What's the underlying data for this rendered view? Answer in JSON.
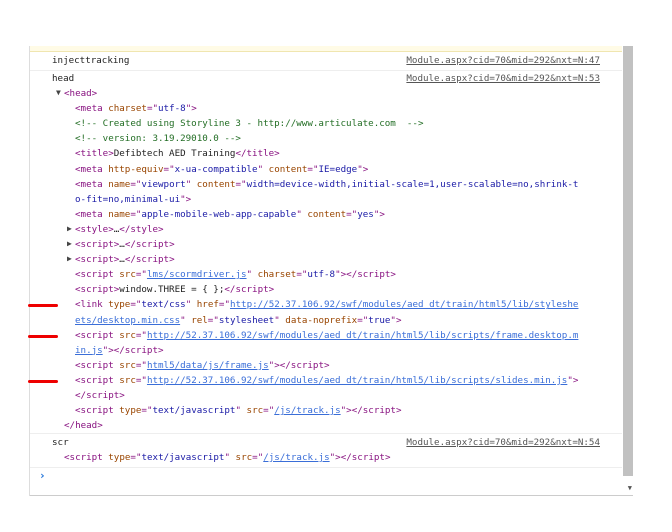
{
  "messages": [
    {
      "label": "injecttracking",
      "source": "Module.aspx?cid=70&mid=292&nxt=N:47"
    },
    {
      "label": "head",
      "source": "Module.aspx?cid=70&mid=292&nxt=N:53"
    },
    {
      "label": "scr",
      "source": "Module.aspx?cid=70&mid=292&nxt=N:54"
    }
  ],
  "head_lines": [
    {
      "indent": 0,
      "tri": "down",
      "tokens": [
        [
          "tag",
          "<head>"
        ]
      ]
    },
    {
      "indent": 1,
      "tokens": [
        [
          "tag",
          "<meta "
        ],
        [
          "attr",
          "charset"
        ],
        [
          "tag",
          "=\""
        ],
        [
          "val",
          "utf-8"
        ],
        [
          "tag",
          "\">"
        ]
      ]
    },
    {
      "indent": 1,
      "tokens": [
        [
          "comment",
          "<!-- Created using Storyline 3 - http://www.articulate.com  -->"
        ]
      ]
    },
    {
      "indent": 1,
      "tokens": [
        [
          "comment",
          "<!-- version: 3.19.29010.0 -->"
        ]
      ]
    },
    {
      "indent": 1,
      "tokens": [
        [
          "tag",
          "<title>"
        ],
        [
          "text",
          "Defibtech AED Training"
        ],
        [
          "tag",
          "</title>"
        ]
      ]
    },
    {
      "indent": 1,
      "tokens": [
        [
          "tag",
          "<meta "
        ],
        [
          "attr",
          "http-equiv"
        ],
        [
          "tag",
          "=\""
        ],
        [
          "val",
          "x-ua-compatible"
        ],
        [
          "tag",
          "\" "
        ],
        [
          "attr",
          "content"
        ],
        [
          "tag",
          "=\""
        ],
        [
          "val",
          "IE=edge"
        ],
        [
          "tag",
          "\">"
        ]
      ]
    },
    {
      "indent": 1,
      "tokens": [
        [
          "tag",
          "<meta "
        ],
        [
          "attr",
          "name"
        ],
        [
          "tag",
          "=\""
        ],
        [
          "val",
          "viewport"
        ],
        [
          "tag",
          "\" "
        ],
        [
          "attr",
          "content"
        ],
        [
          "tag",
          "=\""
        ],
        [
          "val",
          "width=device-width,initial-scale=1,user-scalable=no,shrink-t"
        ]
      ]
    },
    {
      "indent": 1,
      "tokens": [
        [
          "val",
          "o-fit=no,minimal-ui"
        ],
        [
          "tag",
          "\">"
        ]
      ]
    },
    {
      "indent": 1,
      "tokens": [
        [
          "tag",
          "<meta "
        ],
        [
          "attr",
          "name"
        ],
        [
          "tag",
          "=\""
        ],
        [
          "val",
          "apple-mobile-web-app-capable"
        ],
        [
          "tag",
          "\" "
        ],
        [
          "attr",
          "content"
        ],
        [
          "tag",
          "=\""
        ],
        [
          "val",
          "yes"
        ],
        [
          "tag",
          "\">"
        ]
      ]
    },
    {
      "indent": 1,
      "tri": "right",
      "tokens": [
        [
          "tag",
          "<style>"
        ],
        [
          "text",
          "…"
        ],
        [
          "tag",
          "</style>"
        ]
      ]
    },
    {
      "indent": 1,
      "tri": "right",
      "tokens": [
        [
          "tag",
          "<script>"
        ],
        [
          "text",
          "…"
        ],
        [
          "tag",
          "</script>"
        ]
      ]
    },
    {
      "indent": 1,
      "tri": "right",
      "tokens": [
        [
          "tag",
          "<script>"
        ],
        [
          "text",
          "…"
        ],
        [
          "tag",
          "</script>"
        ]
      ]
    },
    {
      "indent": 1,
      "tokens": [
        [
          "tag",
          "<script "
        ],
        [
          "attr",
          "src"
        ],
        [
          "tag",
          "=\""
        ],
        [
          "link",
          "lms/scormdriver.js"
        ],
        [
          "tag",
          "\" "
        ],
        [
          "attr",
          "charset"
        ],
        [
          "tag",
          "=\""
        ],
        [
          "val",
          "utf-8"
        ],
        [
          "tag",
          "\"></script>"
        ]
      ]
    },
    {
      "indent": 1,
      "tokens": [
        [
          "tag",
          "<script>"
        ],
        [
          "text",
          "window.THREE = { };"
        ],
        [
          "tag",
          "</script>"
        ]
      ]
    },
    {
      "indent": 1,
      "mark": true,
      "tokens": [
        [
          "tag",
          "<link "
        ],
        [
          "attr",
          "type"
        ],
        [
          "tag",
          "=\""
        ],
        [
          "val",
          "text/css"
        ],
        [
          "tag",
          "\" "
        ],
        [
          "attr",
          "href"
        ],
        [
          "tag",
          "=\""
        ],
        [
          "link",
          "http://52.37.106.92/swf/modules/aed_dt/train/html5/lib/styleshe"
        ]
      ]
    },
    {
      "indent": 1,
      "tokens": [
        [
          "link",
          "ets/desktop.min.css"
        ],
        [
          "tag",
          "\" "
        ],
        [
          "attr",
          "rel"
        ],
        [
          "tag",
          "=\""
        ],
        [
          "val",
          "stylesheet"
        ],
        [
          "tag",
          "\" "
        ],
        [
          "attr",
          "data-noprefix"
        ],
        [
          "tag",
          "=\""
        ],
        [
          "val",
          "true"
        ],
        [
          "tag",
          "\">"
        ]
      ]
    },
    {
      "indent": 1,
      "mark": true,
      "tokens": [
        [
          "tag",
          "<script "
        ],
        [
          "attr",
          "src"
        ],
        [
          "tag",
          "=\""
        ],
        [
          "link",
          "http://52.37.106.92/swf/modules/aed_dt/train/html5/lib/scripts/frame.desktop.m"
        ]
      ]
    },
    {
      "indent": 1,
      "tokens": [
        [
          "link",
          "in.js"
        ],
        [
          "tag",
          "\"></script>"
        ]
      ]
    },
    {
      "indent": 1,
      "tokens": [
        [
          "tag",
          "<script "
        ],
        [
          "attr",
          "src"
        ],
        [
          "tag",
          "=\""
        ],
        [
          "link",
          "html5/data/js/frame.js"
        ],
        [
          "tag",
          "\"></script>"
        ]
      ]
    },
    {
      "indent": 1,
      "mark": true,
      "tokens": [
        [
          "tag",
          "<script "
        ],
        [
          "attr",
          "src"
        ],
        [
          "tag",
          "=\""
        ],
        [
          "link",
          "http://52.37.106.92/swf/modules/aed_dt/train/html5/lib/scripts/slides.min.js"
        ],
        [
          "tag",
          "\">"
        ]
      ]
    },
    {
      "indent": 1,
      "tokens": [
        [
          "tag",
          "</script>"
        ]
      ]
    },
    {
      "indent": 1,
      "tokens": [
        [
          "tag",
          "<script "
        ],
        [
          "attr",
          "type"
        ],
        [
          "tag",
          "=\""
        ],
        [
          "val",
          "text/javascript"
        ],
        [
          "tag",
          "\" "
        ],
        [
          "attr",
          "src"
        ],
        [
          "tag",
          "=\""
        ],
        [
          "link",
          "/js/track.js"
        ],
        [
          "tag",
          "\"></script>"
        ]
      ]
    },
    {
      "indent": 0,
      "tokens": [
        [
          "tag",
          "</head>"
        ]
      ]
    }
  ],
  "scr_line": {
    "tokens": [
      [
        "tag",
        "<script "
      ],
      [
        "attr",
        "type"
      ],
      [
        "tag",
        "=\""
      ],
      [
        "val",
        "text/javascript"
      ],
      [
        "tag",
        "\" "
      ],
      [
        "attr",
        "src"
      ],
      [
        "tag",
        "=\""
      ],
      [
        "link",
        "/js/track.js"
      ],
      [
        "tag",
        "\"></script>"
      ]
    ]
  },
  "prompt": "›",
  "colors": {
    "tag": "#881280",
    "attr": "#994500",
    "value": "#1a1aa6",
    "comment": "#236e25",
    "link": "#3a6ed8",
    "marker": "#e00000"
  }
}
